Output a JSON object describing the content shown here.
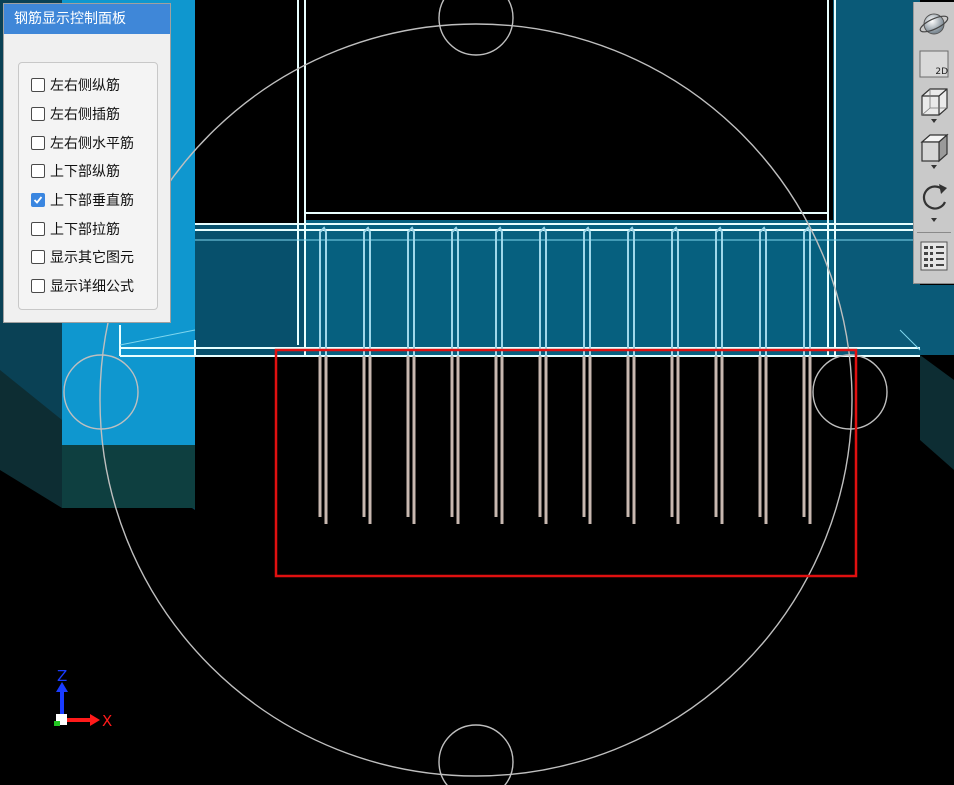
{
  "panel": {
    "title": "钢筋显示控制面板",
    "options": [
      {
        "label": "左右侧纵筋",
        "checked": false
      },
      {
        "label": "左右侧插筋",
        "checked": false
      },
      {
        "label": "左右侧水平筋",
        "checked": false
      },
      {
        "label": "上下部纵筋",
        "checked": false
      },
      {
        "label": "上下部垂直筋",
        "checked": true
      },
      {
        "label": "上下部拉筋",
        "checked": false
      },
      {
        "label": "显示其它图元",
        "checked": false
      },
      {
        "label": "显示详细公式",
        "checked": false
      }
    ]
  },
  "toolbar": {
    "view_2d_label": "2D",
    "icons": [
      "orbit-sphere-icon",
      "view-2d-icon",
      "wireframe-cube-icon",
      "solid-cube-icon",
      "rotate-icon",
      "layer-list-icon"
    ]
  },
  "axes": {
    "z_label": "Z",
    "x_label": "X"
  },
  "colors": {
    "background": "#000000",
    "concrete_dark": "#0b4f6a",
    "concrete_light": "#0e8fc4",
    "rebar": "#c8b8b0",
    "highlight_box": "#e01010",
    "panel_title": "#3f87d8"
  },
  "rebar_count": 12
}
